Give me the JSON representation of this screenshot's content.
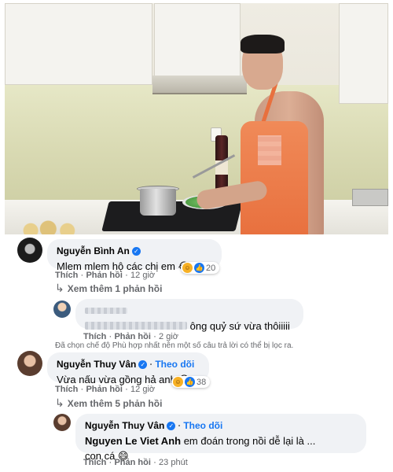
{
  "comments": [
    {
      "author": "Nguyễn Bình An",
      "verified": true,
      "text": "Mlem mlem hộ các chị em",
      "emoji": "😂",
      "actions": {
        "like": "Thích",
        "reply": "Phản hồi",
        "time": "12 giờ"
      },
      "reactions": {
        "count": "20",
        "types": [
          "haha-icon",
          "like-icon"
        ]
      },
      "view_more": "Xem thêm 1 phản hồi"
    },
    {
      "author": "",
      "text_suffix": "ông quỷ sứ vừa thôiiiii",
      "actions": {
        "like": "Thích",
        "reply": "Phản hồi",
        "time": "2 giờ"
      },
      "filter_note": "Đã chọn chế độ Phù hợp nhất nên một số câu trả lời có thể bị lọc ra."
    },
    {
      "author": "Nguyễn Thuy Vân",
      "verified": true,
      "follow_label": "Theo dõi",
      "text": "Vừa nấu vừa gồng hả anh",
      "emoji": "😄",
      "actions": {
        "like": "Thích",
        "reply": "Phản hồi",
        "time": "12 giờ"
      },
      "reactions": {
        "count": "38",
        "types": [
          "haha-icon",
          "like-icon"
        ]
      },
      "view_more": "Xem thêm 5 phản hồi"
    },
    {
      "author": "Nguyễn Thuy Vân",
      "verified": true,
      "follow_label": "Theo dõi",
      "mention": "Nguyen Le Viet Anh",
      "text": "em đoán trong nồi dễ lại là ...",
      "text_line2": "con cá",
      "emoji": "😄",
      "actions": {
        "like": "Thích",
        "reply": "Phản hồi",
        "time": "23 phút"
      }
    }
  ],
  "separator": "·",
  "colors": {
    "bubble": "#f0f2f5",
    "link_blue": "#1877f2",
    "meta_gray": "#65676b"
  }
}
